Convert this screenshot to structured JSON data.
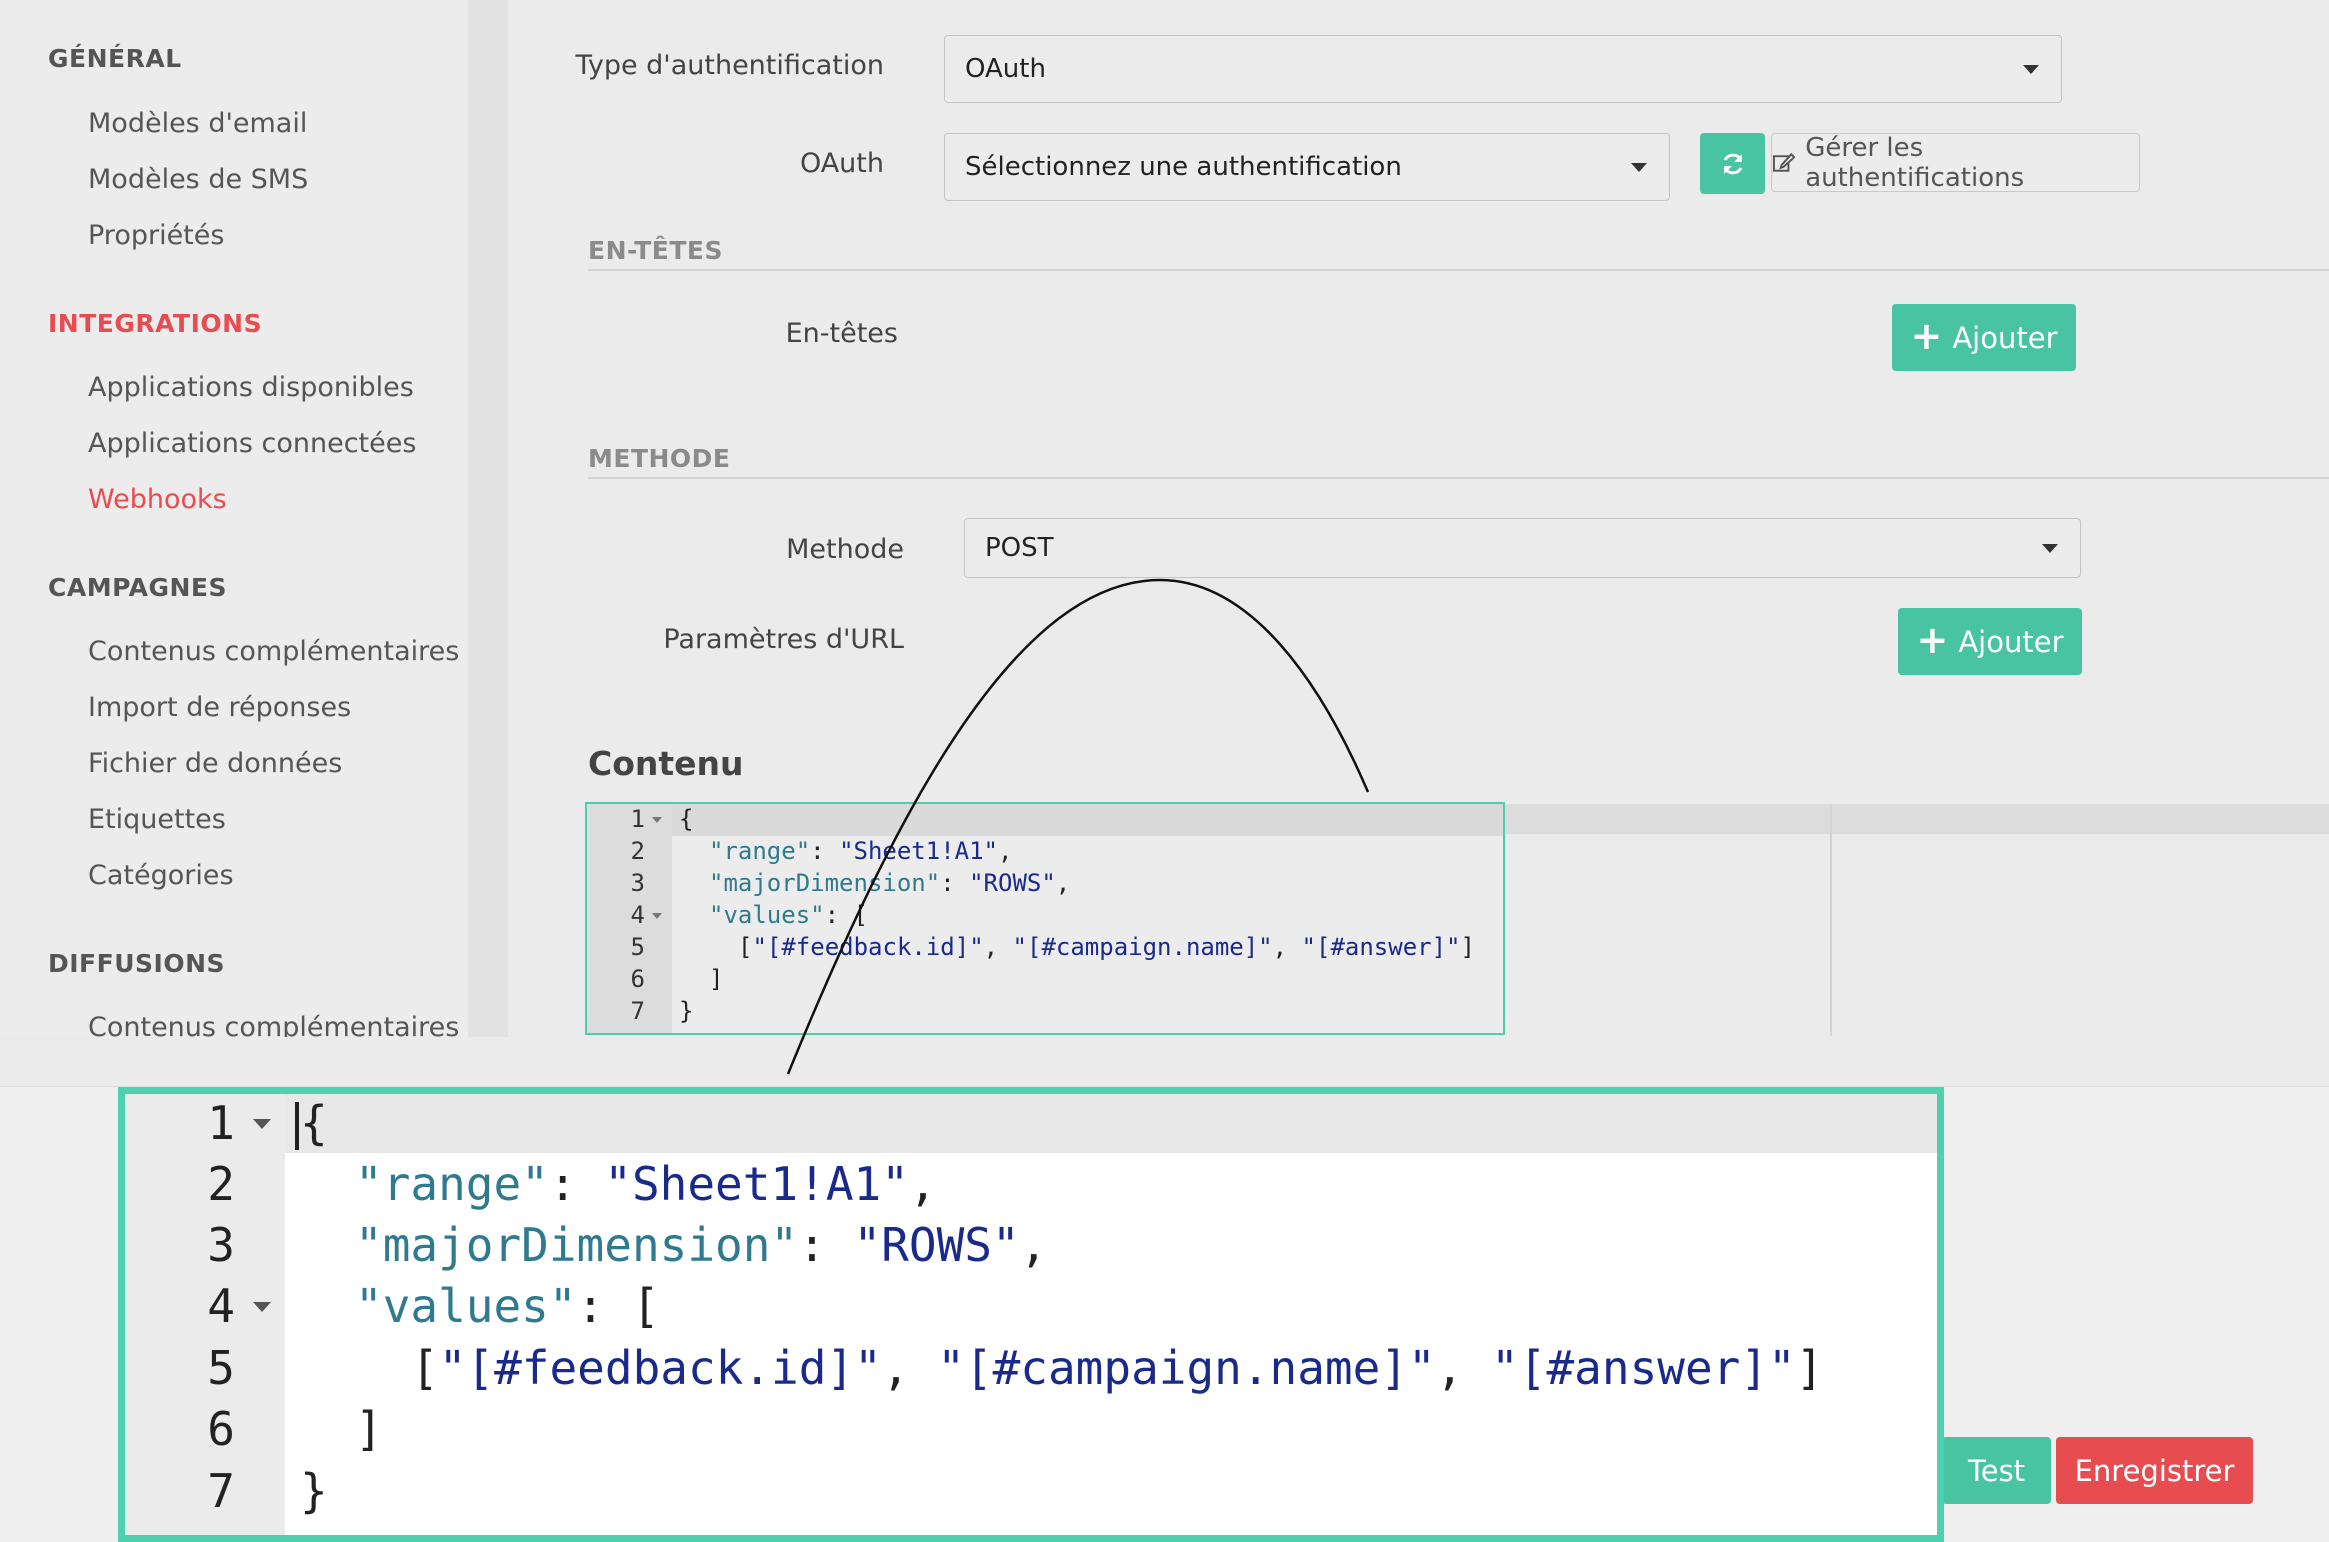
{
  "sidebar": {
    "sections": [
      {
        "label": "GÉNÉRAL",
        "items": [
          "Modèles d'email",
          "Modèles de SMS",
          "Propriétés"
        ]
      },
      {
        "label": "INTEGRATIONS",
        "items": [
          "Applications disponibles",
          "Applications connectées",
          "Webhooks"
        ]
      },
      {
        "label": "CAMPAGNES",
        "items": [
          "Contenus complémentaires",
          "Import de réponses",
          "Fichier de données",
          "Etiquettes",
          "Catégories"
        ]
      },
      {
        "label": "DIFFUSIONS",
        "items": [
          "Contenus complémentaires"
        ]
      }
    ],
    "active_section": "INTEGRATIONS",
    "active_item": "Webhooks"
  },
  "auth": {
    "type_label": "Type d'authentification",
    "type_value": "OAuth",
    "oauth_label": "OAuth",
    "oauth_value": "Sélectionnez une authentification",
    "manage_label": "Gérer les authentifications"
  },
  "headers": {
    "section_title": "EN-TÊTES",
    "label": "En-têtes",
    "add_label": "Ajouter"
  },
  "method": {
    "section_title": "METHODE",
    "label": "Methode",
    "value": "POST",
    "url_params_label": "Paramètres d'URL",
    "add_label": "Ajouter"
  },
  "content": {
    "title": "Contenu",
    "line_numbers": [
      "1",
      "2",
      "3",
      "4",
      "5",
      "6",
      "7"
    ],
    "code": {
      "l1": "{",
      "l2_key": "\"range\"",
      "l2_val": "\"Sheet1!A1\"",
      "l3_key": "\"majorDimension\"",
      "l3_val": "\"ROWS\"",
      "l4_key": "\"values\"",
      "l4_open": "[",
      "l5_v1": "\"[#feedback.id]\"",
      "l5_v2": "\"[#campaign.name]\"",
      "l5_v3": "\"[#answer]\"",
      "l6": "]",
      "l7": "}"
    }
  },
  "actions": {
    "test_label": "Test",
    "save_label": "Enregistrer"
  },
  "colors": {
    "accent_green": "#48c4a3",
    "accent_red": "#e74c50",
    "zoom_border": "#4fd1b0"
  },
  "icons": {
    "refresh": "refresh-icon",
    "edit": "edit-icon",
    "plus": "plus-icon",
    "caret": "caret-down-icon",
    "fold": "fold-arrow-icon"
  }
}
